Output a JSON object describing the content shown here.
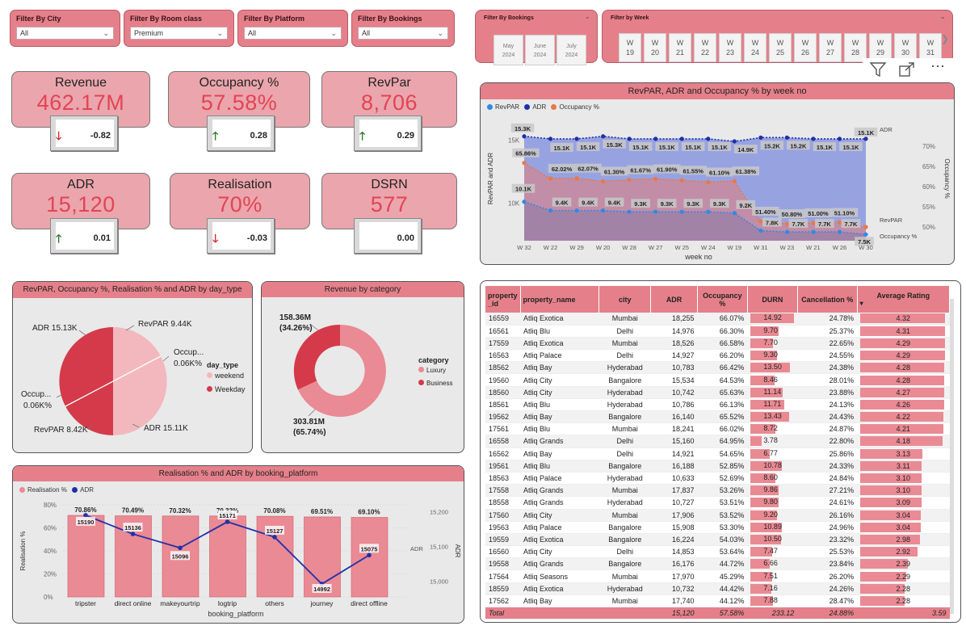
{
  "filters": [
    {
      "title": "Filter By City",
      "value": "All"
    },
    {
      "title": "Filter By Room class",
      "value": "Premium"
    },
    {
      "title": "Filter By Platform",
      "value": "All"
    },
    {
      "title": "Filter By Bookings",
      "value": "All"
    }
  ],
  "slicer_bookings": {
    "title": "Filter By Bookings",
    "months": [
      [
        "May",
        "2024"
      ],
      [
        "June",
        "2024"
      ],
      [
        "July",
        "2024"
      ]
    ]
  },
  "slicer_week": {
    "title": "Filter by Week",
    "weeks": [
      [
        "W",
        "19"
      ],
      [
        "W",
        "20"
      ],
      [
        "W",
        "21"
      ],
      [
        "W",
        "22"
      ],
      [
        "W",
        "23"
      ],
      [
        "W",
        "24"
      ],
      [
        "W",
        "25"
      ],
      [
        "W",
        "26"
      ],
      [
        "W",
        "27"
      ],
      [
        "W",
        "28"
      ],
      [
        "W",
        "29"
      ],
      [
        "W",
        "30"
      ],
      [
        "W",
        "31"
      ]
    ],
    "next": "❯"
  },
  "kpis": [
    {
      "title": "Revenue",
      "value": "462.17M",
      "delta": "-0.82",
      "dir": "down"
    },
    {
      "title": "Occupancy %",
      "value": "57.58%",
      "delta": "0.28",
      "dir": "up"
    },
    {
      "title": "RevPar",
      "value": "8,706",
      "delta": "0.29",
      "dir": "up"
    },
    {
      "title": "ADR",
      "value": "15,120",
      "delta": "0.01",
      "dir": "up"
    },
    {
      "title": "Realisation",
      "value": "70%",
      "delta": "-0.03",
      "dir": "down"
    },
    {
      "title": "DSRN",
      "value": "577",
      "delta": "0.00",
      "dir": "none"
    }
  ],
  "weekly_chart": {
    "title": "RevPAR, ADR and Occupancy % by week no",
    "legend": [
      "RevPAR",
      "ADR",
      "Occupancy %"
    ],
    "xlabel": "week no",
    "ylabel": "RevPAR and ADR",
    "y2label": "Occupancy %",
    "yticks": [
      "15K",
      "10K"
    ],
    "y2ticks": [
      "70%",
      "65%",
      "60%",
      "55%",
      "50%"
    ],
    "end_labels": [
      "ADR",
      "RevPAR",
      "Occupancy %"
    ],
    "colors": {
      "revpar": "#2f8ae6",
      "adr": "#1f2fa8",
      "occ": "#e97848"
    }
  },
  "chart_data": [
    {
      "type": "area",
      "title": "RevPAR, ADR and Occupancy % by week no",
      "x": [
        "W 32",
        "W 22",
        "W 29",
        "W 20",
        "W 28",
        "W 27",
        "W 25",
        "W 24",
        "W 19",
        "W 31",
        "W 23",
        "W 21",
        "W 26",
        "W 30"
      ],
      "series": [
        {
          "name": "ADR",
          "values": [
            15300,
            15100,
            15100,
            15300,
            15100,
            15100,
            15100,
            15100,
            14900,
            15200,
            15200,
            15100,
            15100,
            15100
          ],
          "labels": [
            "15.3K",
            "15.1K",
            "15.1K",
            "15.3K",
            "15.1K",
            "15.1K",
            "15.1K",
            "15.1K",
            "14.9K",
            "15.2K",
            "15.2K",
            "15.1K",
            "15.1K",
            "15.1K"
          ]
        },
        {
          "name": "RevPAR",
          "values": [
            10100,
            9400,
            9400,
            9400,
            9300,
            9300,
            9300,
            9300,
            9200,
            7800,
            7700,
            7700,
            7700,
            7500
          ],
          "labels": [
            "10.1K",
            "9.4K",
            "9.4K",
            "9.4K",
            "9.3K",
            "9.3K",
            "9.3K",
            "9.3K",
            "9.2K",
            "7.8K",
            "7.7K",
            "7.7K",
            "7.7K",
            "7.5K"
          ]
        },
        {
          "name": "Occupancy %",
          "values": [
            65.86,
            62.02,
            62.07,
            61.3,
            61.67,
            61.9,
            61.55,
            61.1,
            61.38,
            51.4,
            50.8,
            51.0,
            51.1,
            50.0
          ],
          "labels": [
            "65.86%",
            "62.02%",
            "62.07%",
            "61.30%",
            "61.67%",
            "61.90%",
            "61.55%",
            "61.10%",
            "61.38%",
            "51.40%",
            "50.80%",
            "51.00%",
            "51.10%",
            ""
          ]
        }
      ],
      "ylabel": "RevPAR and ADR",
      "xlabel": "week no"
    },
    {
      "type": "pie",
      "title": "RevPAR, Occupancy %, Realisation % and ADR by day_type",
      "legend_title": "day_type",
      "categories": [
        "weekend",
        "Weekday"
      ],
      "labels": {
        "weekend": [
          "RevPAR 9.44K",
          "Occup... 0.06K%",
          "ADR 15.11K"
        ],
        "weekday": [
          "ADR 15.13K",
          "Occup... 0.06K%",
          "RevPAR 8.42K"
        ]
      },
      "values": [
        50,
        50
      ]
    },
    {
      "type": "pie",
      "title": "Revenue by category",
      "legend_title": "category",
      "categories": [
        "Luxury",
        "Business"
      ],
      "values": [
        303.81,
        158.36
      ],
      "labels": [
        "303.81M (65.74%)",
        "158.36M (34.26%)"
      ]
    },
    {
      "type": "bar",
      "title": "Realisation % and ADR by booking_platform",
      "categories": [
        "tripster",
        "direct online",
        "makeyourtrip",
        "logtrip",
        "others",
        "journey",
        "direct offline"
      ],
      "series": [
        {
          "name": "Realisation %",
          "values": [
            70.86,
            70.49,
            70.32,
            70.32,
            70.08,
            69.51,
            69.1
          ],
          "labels": [
            "70.86%",
            "70.49%",
            "70.32%",
            "70.32%",
            "70.08%",
            "69.51%",
            "69.10%"
          ]
        },
        {
          "name": "ADR",
          "values": [
            15190,
            15136,
            15096,
            15171,
            15127,
            14992,
            15075
          ],
          "labels": [
            "15190",
            "15136",
            "15096",
            "15171",
            "15127",
            "14992",
            "15075"
          ]
        }
      ],
      "xlabel": "booking_platform",
      "ylabel": "Realisation %",
      "y2label": "ADR"
    }
  ],
  "pie_panel": {
    "title": "RevPAR, Occupancy %, Realisation % and ADR by day_type",
    "legend_title": "day_type",
    "legend": [
      "weekend",
      "Weekday"
    ],
    "labels": {
      "l1": "ADR 15.13K",
      "l2": "RevPAR 9.44K",
      "l3": "Occup...",
      "l3b": "0.06K%",
      "l4": "Occup...",
      "l4b": "0.06K%",
      "l5": "RevPAR 8.42K",
      "l6": "ADR 15.11K"
    }
  },
  "donut_panel": {
    "title": "Revenue by category",
    "legend_title": "category",
    "legend": [
      "Luxury",
      "Business"
    ],
    "top_label": "158.36M",
    "top_pct": "(34.26%)",
    "bot_label": "303.81M",
    "bot_pct": "(65.74%)"
  },
  "platform_panel": {
    "title": "Realisation % and ADR by booking_platform",
    "legend": [
      "Realisation %",
      "ADR"
    ],
    "yticks": [
      "80%",
      "60%",
      "40%",
      "20%",
      "0%"
    ],
    "y2ticks": [
      "15,200",
      "15,100",
      "15,000"
    ],
    "ylabel": "Realisation %",
    "y2label": "ADR",
    "xlabel": "booking_platform",
    "adr_axis_label": "ADR"
  },
  "table": {
    "headers": [
      "property _id",
      "property_name",
      "city",
      "ADR",
      "Occupancy %",
      "DURN",
      "Cancellation %",
      "Average Rating"
    ],
    "sort_indicator": "▾",
    "rows": [
      [
        "16559",
        "Atliq Exotica",
        "Mumbai",
        "18,255",
        "66.07%",
        "14.92",
        "24.78%",
        "4.32"
      ],
      [
        "16561",
        "Atliq Blu",
        "Delhi",
        "14,976",
        "66.30%",
        "9.70",
        "25.37%",
        "4.31"
      ],
      [
        "17559",
        "Atliq Exotica",
        "Mumbai",
        "18,526",
        "66.58%",
        "7.70",
        "22.65%",
        "4.29"
      ],
      [
        "16563",
        "Atliq Palace",
        "Delhi",
        "14,927",
        "66.20%",
        "9.30",
        "24.55%",
        "4.29"
      ],
      [
        "18562",
        "Atliq Bay",
        "Hyderabad",
        "10,783",
        "66.42%",
        "13.50",
        "24.38%",
        "4.28"
      ],
      [
        "19560",
        "Atliq City",
        "Bangalore",
        "15,534",
        "64.53%",
        "8.46",
        "28.01%",
        "4.28"
      ],
      [
        "18560",
        "Atliq City",
        "Hyderabad",
        "10,742",
        "65.63%",
        "11.14",
        "23.88%",
        "4.27"
      ],
      [
        "18561",
        "Atliq Blu",
        "Hyderabad",
        "10,786",
        "66.13%",
        "11.71",
        "24.13%",
        "4.26"
      ],
      [
        "19562",
        "Atliq Bay",
        "Bangalore",
        "16,140",
        "65.52%",
        "13.43",
        "24.43%",
        "4.22"
      ],
      [
        "17561",
        "Atliq Blu",
        "Mumbai",
        "18,241",
        "66.02%",
        "8.72",
        "24.87%",
        "4.21"
      ],
      [
        "16558",
        "Atliq Grands",
        "Delhi",
        "15,160",
        "64.95%",
        "3.78",
        "22.80%",
        "4.18"
      ],
      [
        "16562",
        "Atliq Bay",
        "Delhi",
        "14,921",
        "54.65%",
        "6.77",
        "25.86%",
        "3.13"
      ],
      [
        "19561",
        "Atliq Blu",
        "Bangalore",
        "16,188",
        "52.85%",
        "10.78",
        "24.33%",
        "3.11"
      ],
      [
        "18563",
        "Atliq Palace",
        "Hyderabad",
        "10,633",
        "52.69%",
        "8.60",
        "24.84%",
        "3.10"
      ],
      [
        "17558",
        "Atliq Grands",
        "Mumbai",
        "17,837",
        "53.26%",
        "9.86",
        "27.21%",
        "3.10"
      ],
      [
        "18558",
        "Atliq Grands",
        "Hyderabad",
        "10,727",
        "53.51%",
        "9.80",
        "24.61%",
        "3.09"
      ],
      [
        "17560",
        "Atliq City",
        "Mumbai",
        "17,906",
        "53.52%",
        "9.20",
        "26.16%",
        "3.04"
      ],
      [
        "19563",
        "Atliq Palace",
        "Bangalore",
        "15,908",
        "53.30%",
        "10.89",
        "24.96%",
        "3.04"
      ],
      [
        "19559",
        "Atliq Exotica",
        "Bangalore",
        "16,224",
        "54.03%",
        "10.50",
        "23.32%",
        "2.98"
      ],
      [
        "16560",
        "Atliq City",
        "Delhi",
        "14,853",
        "53.64%",
        "7.47",
        "25.53%",
        "2.92"
      ],
      [
        "19558",
        "Atliq Grands",
        "Bangalore",
        "16,176",
        "44.72%",
        "6.66",
        "23.84%",
        "2.39"
      ],
      [
        "17564",
        "Atliq Seasons",
        "Mumbai",
        "17,970",
        "45.29%",
        "7.51",
        "26.20%",
        "2.29"
      ],
      [
        "18559",
        "Atliq Exotica",
        "Hyderabad",
        "10,732",
        "44.42%",
        "7.16",
        "24.26%",
        "2.28"
      ],
      [
        "17562",
        "Atliq Bay",
        "Mumbai",
        "17,740",
        "44.12%",
        "7.88",
        "28.47%",
        "2.28"
      ]
    ],
    "total": [
      "Total",
      "",
      "",
      "15,120",
      "57.58%",
      "233.12",
      "24.88%",
      "3.59"
    ]
  },
  "toolbar": {
    "filter_icon": "filter-icon",
    "focus_icon": "focus-mode-icon",
    "more": "⋯"
  }
}
